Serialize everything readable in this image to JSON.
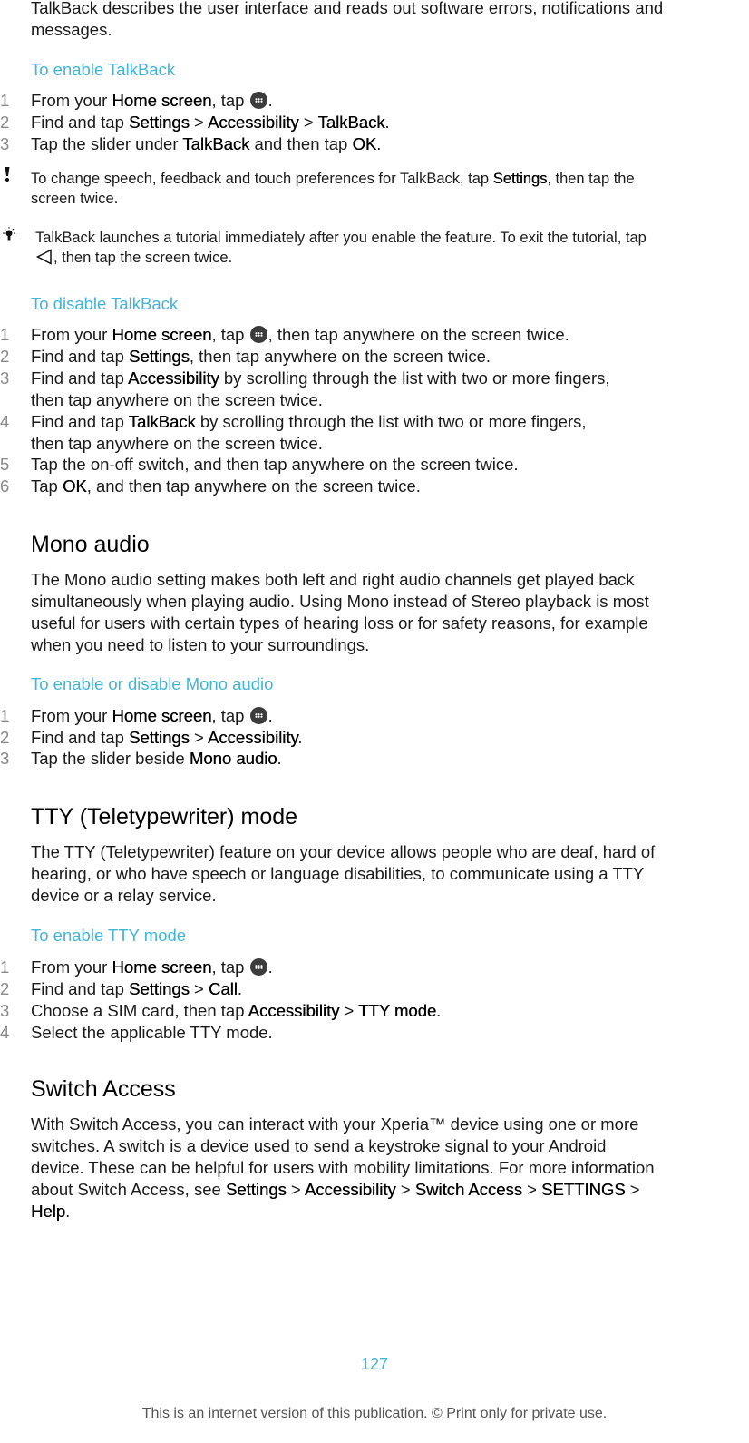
{
  "intro": {
    "line1": "TalkBack describes the user interface and reads out software errors, notifications and",
    "line2": "messages."
  },
  "enable_talkback": {
    "title": "To enable TalkBack",
    "steps": [
      {
        "n": "1",
        "pre": "From your ",
        "b1": "Home screen",
        "mid": ", tap ",
        "icon": "apps-icon",
        "post": "."
      },
      {
        "n": "2",
        "pre": "Find and tap ",
        "b1": "Settings",
        "sep1": " > ",
        "b2": "Accessibility",
        "sep2": " > ",
        "b3": "TalkBack",
        "post": "."
      },
      {
        "n": "3",
        "pre": "Tap the slider under ",
        "b1": "TalkBack",
        "mid": " and then tap ",
        "b2": "OK",
        "post": "."
      }
    ],
    "note": {
      "icon": "exclamation-icon",
      "pre": "To change speech, feedback and touch preferences for TalkBack, tap ",
      "b1": "Settings",
      "post1": ", then tap the",
      "line2": "screen twice."
    },
    "tip": {
      "icon": "lightbulb-icon",
      "line1": "TalkBack launches a tutorial immediately after you enable the feature. To exit the tutorial, tap",
      "back_icon": "back-triangle-icon",
      "line2": ", then tap the screen twice."
    }
  },
  "disable_talkback": {
    "title": "To disable TalkBack",
    "steps": [
      {
        "n": "1",
        "pre": "From your ",
        "b1": "Home screen",
        "mid": ", tap ",
        "icon": "apps-icon",
        "post": ", then tap anywhere on the screen twice."
      },
      {
        "n": "2",
        "pre": "Find and tap ",
        "b1": "Settings",
        "post": ", then tap anywhere on the screen twice."
      },
      {
        "n": "3",
        "pre": "Find and tap ",
        "b1": "Accessibility",
        "post": " by scrolling through the list with two or more fingers,",
        "line2": "then tap anywhere on the screen twice."
      },
      {
        "n": "4",
        "pre": "Find and tap ",
        "b1": "TalkBack",
        "post": " by scrolling through the list with two or more fingers,",
        "line2": "then tap anywhere on the screen twice."
      },
      {
        "n": "5",
        "pre": "Tap the on-off switch, and then tap anywhere on the screen twice."
      },
      {
        "n": "6",
        "pre": "Tap ",
        "b1": "OK",
        "post": ", and then tap anywhere on the screen twice."
      }
    ]
  },
  "mono_audio": {
    "heading": "Mono audio",
    "body": [
      "The Mono audio setting makes both left and right audio channels get played back",
      "simultaneously when playing audio. Using Mono instead of Stereo playback is most",
      "useful for users with certain types of hearing loss or for safety reasons, for example",
      "when you need to listen to your surroundings."
    ],
    "title": "To enable or disable Mono audio",
    "steps": [
      {
        "n": "1",
        "pre": "From your ",
        "b1": "Home screen",
        "mid": ", tap ",
        "icon": "apps-icon",
        "post": "."
      },
      {
        "n": "2",
        "pre": "Find and tap ",
        "b1": "Settings",
        "sep1": " > ",
        "b2": "Accessibility",
        "post": "."
      },
      {
        "n": "3",
        "pre": "Tap the slider beside ",
        "b1": "Mono audio",
        "post": "."
      }
    ]
  },
  "tty": {
    "heading": "TTY (Teletypewriter) mode",
    "body": [
      "The TTY (Teletypewriter) feature on your device allows people who are deaf, hard of",
      "hearing, or who have speech or language disabilities, to communicate using a TTY",
      "device or a relay service."
    ],
    "title": "To enable TTY mode",
    "steps": [
      {
        "n": "1",
        "pre": "From your ",
        "b1": "Home screen",
        "mid": ", tap ",
        "icon": "apps-icon",
        "post": "."
      },
      {
        "n": "2",
        "pre": "Find and tap ",
        "b1": "Settings",
        "sep1": " > ",
        "b2": "Call",
        "post": "."
      },
      {
        "n": "3",
        "pre": "Choose a SIM card, then tap ",
        "b1": "Accessibility",
        "sep1": " > ",
        "b2": "TTY mode",
        "post": "."
      },
      {
        "n": "4",
        "pre": "Select the applicable TTY mode."
      }
    ]
  },
  "switch_access": {
    "heading": "Switch Access",
    "body": [
      "With Switch Access, you can interact with your Xperia™ device using one or more",
      "switches. A switch is a device used to send a keystroke signal to your Android",
      "device. These can be helpful for users with mobility limitations. For more information"
    ],
    "line4_pre": "about Switch Access, see ",
    "path": [
      "Settings",
      "Accessibility",
      "Switch Access",
      "SETTINGS",
      "Help"
    ],
    "sep": " > ",
    "end": "."
  },
  "footer": {
    "page_number": "127",
    "notice": "This is an internet version of this publication. © Print only for private use."
  },
  "colors": {
    "accent": "#41b6d8",
    "text": "#1a1a1a",
    "step_number": "#8a8a8a"
  }
}
